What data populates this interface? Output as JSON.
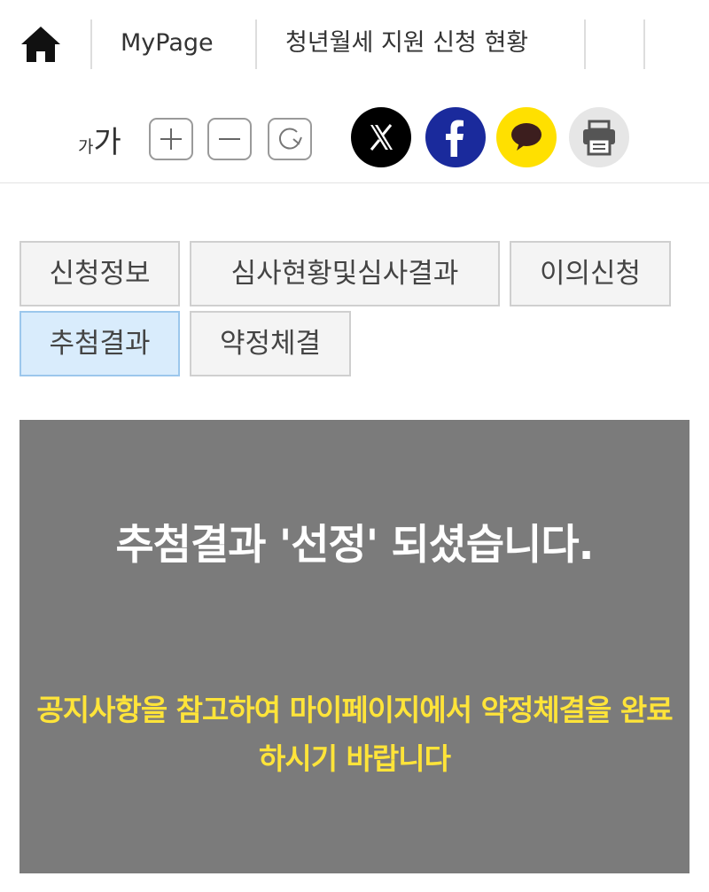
{
  "breadcrumb": {
    "home_icon": "home-icon",
    "items": [
      "MyPage",
      "청년월세 지원 신청 현황"
    ]
  },
  "tools": {
    "font_sample_small": "가",
    "font_sample_large": "가",
    "font_buttons": [
      "plus-icon",
      "minus-icon",
      "reset-icon"
    ],
    "share_buttons": [
      {
        "icon": "x-twitter-icon",
        "color": "#000000"
      },
      {
        "icon": "facebook-icon",
        "color": "#1a2a9c"
      },
      {
        "icon": "kakaotalk-icon",
        "color": "#ffe000"
      },
      {
        "icon": "print-icon",
        "color": "#e6e6e6"
      }
    ]
  },
  "tabs": [
    {
      "label": "신청정보",
      "active": false
    },
    {
      "label": "심사현황및심사결과",
      "active": false
    },
    {
      "label": "이의신청",
      "active": false
    },
    {
      "label": "추첨결과",
      "active": true
    },
    {
      "label": "약정체결",
      "active": false
    }
  ],
  "result": {
    "title": "추첨결과 '선정' 되셨습니다.",
    "message": "공지사항을 참고하여 마이페이지에서 약정체결을 완료하시기 바랍니다",
    "background": "#7b7b7b",
    "title_color": "#ffffff",
    "message_color": "#ffe439"
  }
}
